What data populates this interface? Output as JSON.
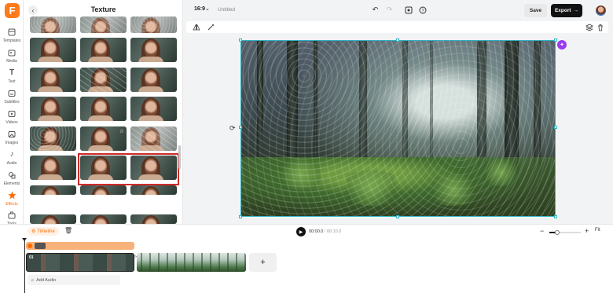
{
  "app": {
    "logo_letter": "F",
    "accent_color": "#ff6a00",
    "selection_color": "#2fb4c5",
    "highlight_color": "#d12a2a"
  },
  "rail": {
    "items": [
      {
        "label": "Templates",
        "icon": "templates-icon"
      },
      {
        "label": "Media",
        "icon": "media-icon"
      },
      {
        "label": "Text",
        "icon": "text-icon"
      },
      {
        "label": "Subtitles",
        "icon": "subtitles-icon"
      },
      {
        "label": "Videos",
        "icon": "videos-icon"
      },
      {
        "label": "Images",
        "icon": "images-icon"
      },
      {
        "label": "Audio",
        "icon": "audio-icon"
      },
      {
        "label": "Elements",
        "icon": "elements-icon"
      },
      {
        "label": "Effects",
        "icon": "effects-icon",
        "active": true
      },
      {
        "label": "Tools",
        "icon": "tools-icon"
      }
    ]
  },
  "panel": {
    "title": "Texture"
  },
  "topbar": {
    "ratio": "16:9",
    "doc_title": "Untitled",
    "save_label": "Save",
    "export_label": "Export"
  },
  "playbar": {
    "timeline_label": "Timeline",
    "current_time": "00:00.0",
    "total_time": "/ 00:10.0",
    "zoom_level": 0.25,
    "fit_label": "Fit"
  },
  "timeline": {
    "clip_number": "01",
    "add_audio_label": "Add Audio"
  }
}
